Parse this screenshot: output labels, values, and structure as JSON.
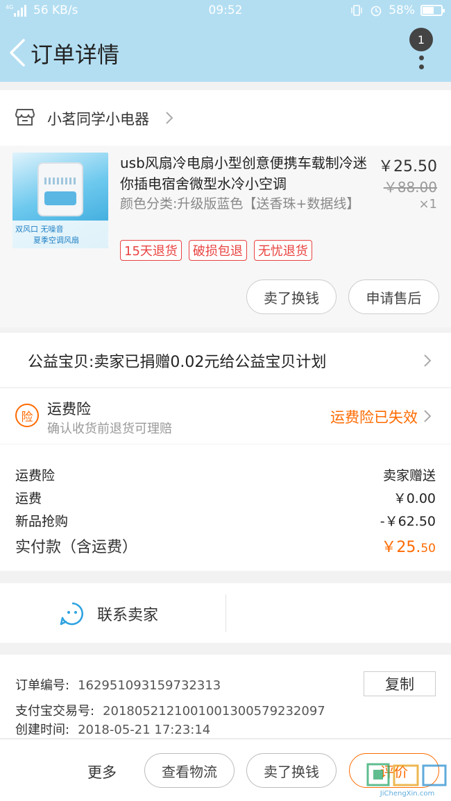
{
  "status_bar": {
    "network": "4G",
    "speed": "56 KB/s",
    "time": "09:52",
    "battery": "58%",
    "battery_level": 0.58
  },
  "header": {
    "title": "订单详情",
    "badge_count": "1"
  },
  "shop": {
    "name": "小茗同学小电器"
  },
  "product": {
    "title": "usb风扇冷电扇小型创意便携车载制冷迷你插电宿舍微型水冷小空调",
    "spec": "颜色分类:升级版蓝色【送香珠+数据线】",
    "price": "￥25.50",
    "original_price": "￥88.00",
    "quantity": "×1",
    "image_text_1": "双风口 无噪音",
    "image_text_2": "夏季空调风扇",
    "tags": [
      "15天退货",
      "破损包退",
      "无忧退货"
    ],
    "actions": [
      "卖了换钱",
      "申请售后"
    ]
  },
  "charity": {
    "text": "公益宝贝:卖家已捐赠0.02元给公益宝贝计划"
  },
  "insurance": {
    "icon_text": "险",
    "title": "运费险",
    "subtitle": "确认收货前退货可理赔",
    "status": "运费险已失效"
  },
  "fees": [
    {
      "label": "运费险",
      "value": "卖家赠送"
    },
    {
      "label": "运费",
      "value": "￥0.00"
    },
    {
      "label": "新品抢购",
      "value": "-￥62.50"
    }
  ],
  "total": {
    "label": "实付款（含运费）",
    "currency": "￥",
    "integer": "25.",
    "decimal": "50"
  },
  "contact": {
    "label": "联系卖家"
  },
  "order_info": {
    "order_no_label": "订单编号:",
    "order_no": "162951093159732313",
    "copy_label": "复制",
    "alipay_label": "支付宝交易号:",
    "alipay_no": "2018052121001001300579232097",
    "created_label": "创建时间:",
    "created_time": "2018-05-21 17:23:14"
  },
  "bottom_bar": {
    "more": "更多",
    "buttons": [
      "查看物流",
      "卖了换钱",
      "评价"
    ]
  },
  "watermark": {
    "text": "JiChengXin.com"
  },
  "colors": {
    "header_bg": "#b3def2",
    "accent_orange": "#ff6a00",
    "tag_red": "#e8423f"
  }
}
